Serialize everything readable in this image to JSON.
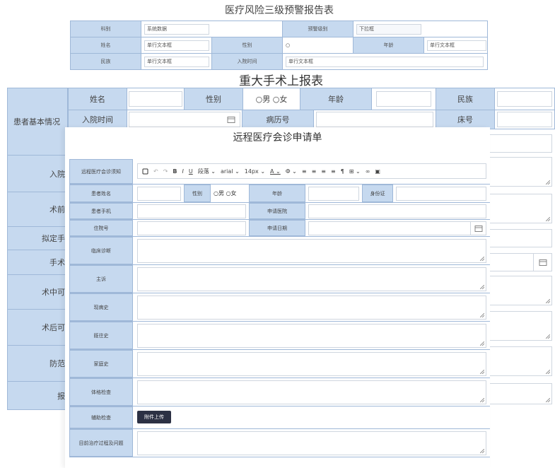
{
  "form1": {
    "title": "医疗风险三级预警报告表",
    "r1": {
      "l1": "科别",
      "v1": "系统数据",
      "l2": "预警级别",
      "v2": "下拉框"
    },
    "r2": {
      "l1": "姓名",
      "v1": "单行文本框",
      "l2": "性别",
      "v2": "○",
      "l3": "年龄",
      "v3": "单行文本框"
    },
    "r3": {
      "l1": "民族",
      "v1": "单行文本框",
      "l2": "入院时间",
      "v2": "单行文本框"
    }
  },
  "form2": {
    "title": "重大手术上报表",
    "left_labels": [
      "患者基本情况",
      "入院",
      "术前",
      "拟定手",
      "手术",
      "术中可",
      "术后可",
      "防范",
      "报"
    ],
    "name_label": "姓名",
    "gender_label": "性别",
    "gender_options": "○男 ○女",
    "age_label": "年龄",
    "ethnicity_label": "民族",
    "admit_label": "入院时间",
    "record_label": "病历号",
    "bed_label": "床号"
  },
  "form3": {
    "title": "远程医疗会诊申请单",
    "toolbar_label": "远程医疗会诊须知",
    "toolbar": {
      "para": "段落",
      "font": "arial",
      "size": "14px"
    },
    "patient_name": "患者姓名",
    "gender": "性别",
    "gender_options": "○男 ○女",
    "age": "年龄",
    "id_card": "身份证",
    "phone": "患者手机",
    "apply_hospital": "申请医院",
    "inpatient_no": "住院号",
    "apply_date": "申请日期",
    "diagnosis": "临床诊断",
    "complaint": "主诉",
    "present_history": "现病史",
    "past_history": "既往史",
    "family_history": "家庭史",
    "physical_exam": "体格检查",
    "aux_exam": "辅助检查",
    "upload": "附件上传",
    "current_treatment": "目前治疗过程及问题"
  }
}
